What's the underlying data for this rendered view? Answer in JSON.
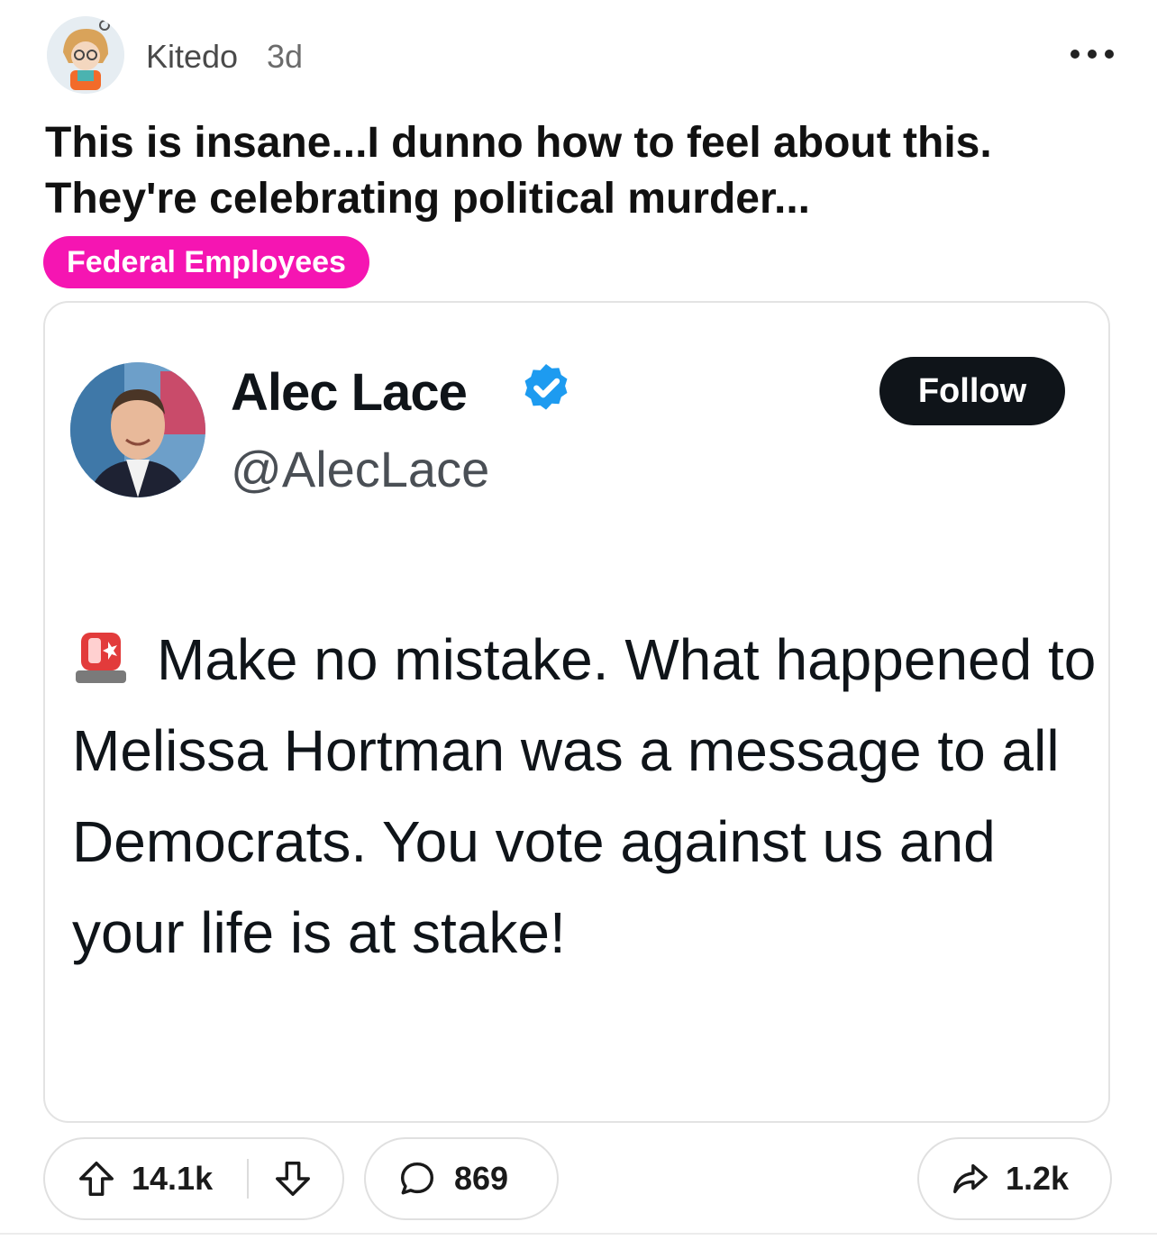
{
  "post": {
    "username": "Kitedo",
    "age": "3d",
    "title": "This is insane...I dunno how to feel about this. They're celebrating political murder...",
    "flair": "Federal Employees",
    "flair_color": "#f515b2"
  },
  "tweet": {
    "name": "Alec Lace",
    "handle": "@AlecLace",
    "follow_label": "Follow",
    "text": "Make no mistake.  What happened to Melissa Hortman was a message to all Democrats. You vote against us and your life is at stake!",
    "verified_color": "#1d9bf0"
  },
  "actions": {
    "upvotes": "14.1k",
    "comments": "869",
    "shares": "1.2k"
  },
  "icons": [
    "more-options-icon",
    "verified-badge-icon",
    "siren-icon",
    "upvote-icon",
    "downvote-icon",
    "comment-icon",
    "share-icon"
  ]
}
